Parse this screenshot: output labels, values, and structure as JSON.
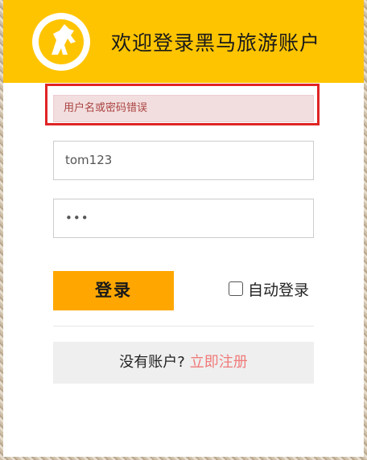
{
  "header": {
    "title": "欢迎登录黑马旅游账户"
  },
  "error": {
    "message": "用户名或密码错误"
  },
  "form": {
    "username_value": "tom123",
    "password_value": "•••",
    "login_label": "登录",
    "auto_login_label": "自动登录"
  },
  "register": {
    "question": "没有账户?",
    "link_label": "立即注册"
  },
  "colors": {
    "header_bg": "#ffc400",
    "login_button": "#ffa700",
    "error_bg": "#f2dede",
    "error_text": "#a94442",
    "highlight": "#e02424",
    "register_link": "#f07a7a"
  },
  "icons": {
    "logo": "horse-logo-icon"
  }
}
